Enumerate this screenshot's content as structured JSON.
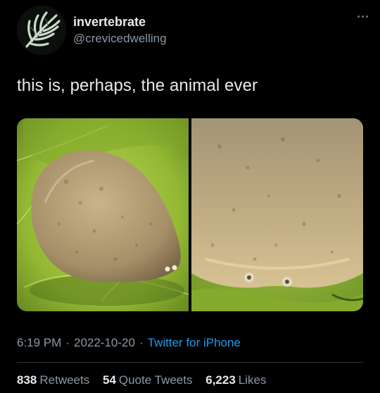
{
  "author": {
    "display_name": "invertebrate",
    "handle": "@crevicedwelling",
    "avatar_icon": "fern-leaf-avatar"
  },
  "tweet": {
    "text": "this is, perhaps, the animal ever"
  },
  "media": [
    {
      "name": "slug-photo-full-body",
      "subject": "slug-on-leaf"
    },
    {
      "name": "slug-photo-closeup",
      "subject": "slug-head-closeup"
    }
  ],
  "meta": {
    "time": "6:19 PM",
    "separator": "·",
    "date": "2022-10-20",
    "source": "Twitter for iPhone"
  },
  "stats": [
    {
      "count": "838",
      "label": "Retweets"
    },
    {
      "count": "54",
      "label": "Quote Tweets"
    },
    {
      "count": "6,223",
      "label": "Likes"
    }
  ],
  "colors": {
    "background": "#000000",
    "text_primary": "#e7e9ea",
    "text_secondary": "#8b98a5",
    "link": "#1d9bf0",
    "divider": "#2f3336"
  }
}
